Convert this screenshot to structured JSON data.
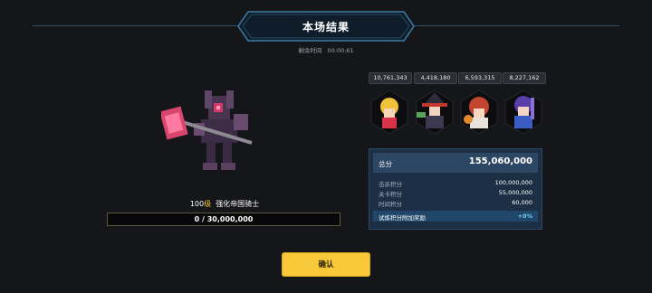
{
  "header": {
    "title": "本场结果",
    "time_label": "剩余时间",
    "time_value": "00:00.61"
  },
  "boss": {
    "level": "100",
    "level_suffix": "级",
    "name": "强化帝国骑士",
    "hp_text": "0 / 30,000,000",
    "hp_fraction": 0
  },
  "party": [
    {
      "damage": "10,761,343",
      "icon": "blonde-hero-icon"
    },
    {
      "damage": "4,418,180",
      "icon": "dark-witch-hero-icon"
    },
    {
      "damage": "6,593,315",
      "icon": "red-hair-hero-icon"
    },
    {
      "damage": "8,227,162",
      "icon": "purple-mage-hero-icon"
    }
  ],
  "score": {
    "total_label": "总分",
    "total_value": "155,060,000",
    "rows": [
      {
        "label": "击杀积分",
        "value": "100,000,000"
      },
      {
        "label": "关卡积分",
        "value": "55,000,000"
      },
      {
        "label": "时间积分",
        "value": "60,000"
      }
    ],
    "bonus": {
      "label": "试炼积分附加奖励",
      "value": "+0%"
    }
  },
  "confirm_label": "确认",
  "colors": {
    "accent": "#f6c83a",
    "panel": "#1c2f44",
    "bonus": "#7fd0ff"
  }
}
